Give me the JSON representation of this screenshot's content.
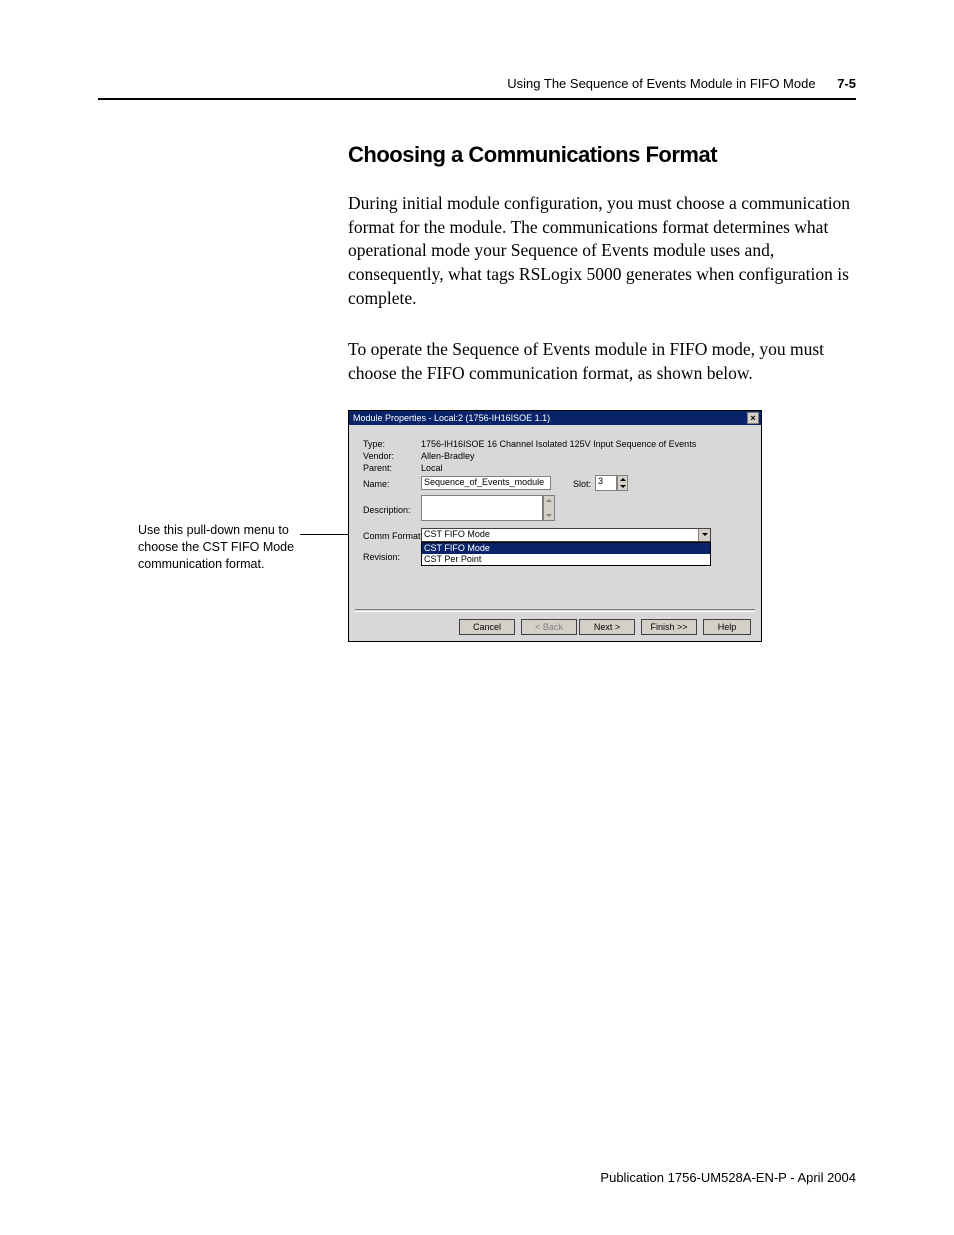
{
  "header": {
    "chapter": "Using The Sequence of Events Module in FIFO Mode",
    "page": "7-5"
  },
  "section": {
    "title": "Choosing a Communications Format",
    "para1": "During initial module configuration, you must choose a communication format for the module. The communications format determines what operational mode your Sequence of Events module uses and, consequently, what tags RSLogix 5000 generates when configuration is complete.",
    "para2": "To operate the Sequence of Events module in FIFO mode, you must choose the FIFO communication format, as shown below."
  },
  "callout": "Use this pull-down menu to choose the CST FIFO Mode communication format.",
  "dialog": {
    "title": "Module Properties - Local:2 (1756-IH16ISOE 1.1)",
    "close": "×",
    "rows": {
      "type_label": "Type:",
      "type_value": "1756-IH16ISOE 16 Channel Isolated 125V Input Sequence of Events",
      "vendor_label": "Vendor:",
      "vendor_value": "Allen-Bradley",
      "parent_label": "Parent:",
      "parent_value": "Local",
      "name_label": "Name:",
      "name_value": "Sequence_of_Events_module",
      "slot_label": "Slot:",
      "slot_value": "3",
      "desc_label": "Description:",
      "comm_label": "Comm Format:",
      "comm_value": "CST FIFO Mode",
      "rev_label": "Revision:"
    },
    "options": [
      "CST FIFO Mode",
      "CST Per Point"
    ],
    "buttons": {
      "cancel": "Cancel",
      "back": "< Back",
      "next": "Next >",
      "finish": "Finish >>",
      "help": "Help"
    }
  },
  "footer": "Publication 1756-UM528A-EN-P - April 2004"
}
